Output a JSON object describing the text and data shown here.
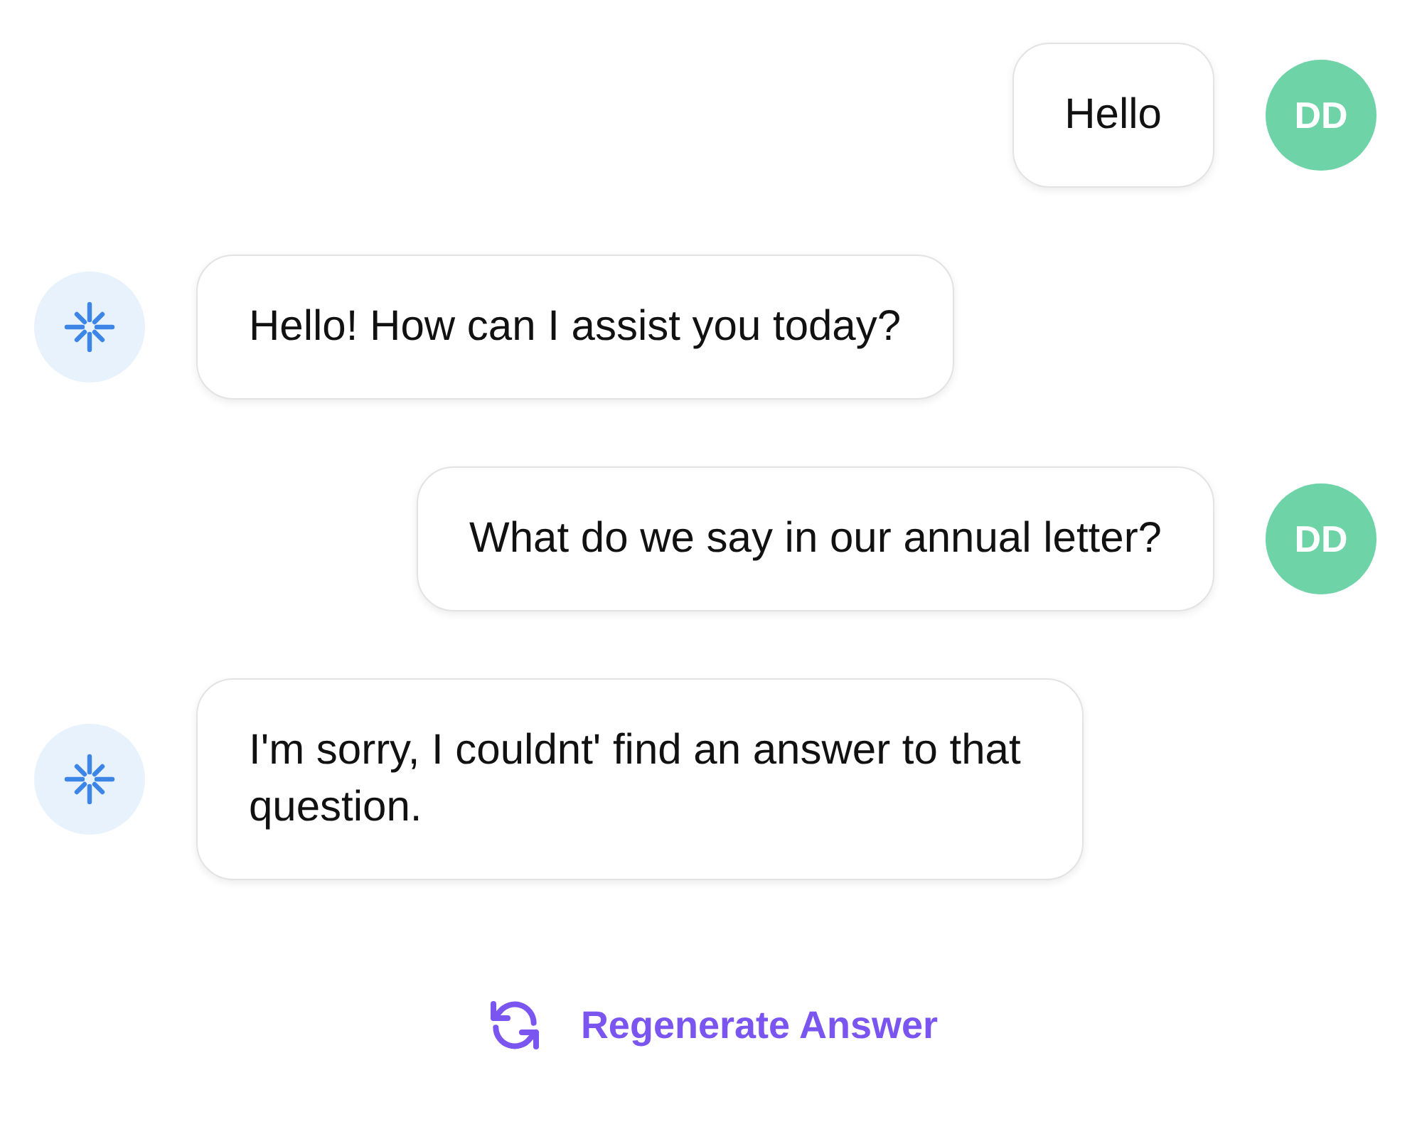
{
  "messages": [
    {
      "kind": "user",
      "avatar": "DD",
      "text": "Hello"
    },
    {
      "kind": "bot",
      "text": "Hello! How can I assist you today?"
    },
    {
      "kind": "user",
      "avatar": "DD",
      "text": "What do we say in our annual letter?"
    },
    {
      "kind": "bot",
      "text": "I'm sorry, I couldnt' find an answer to that question."
    }
  ],
  "regenerate": {
    "label": "Regenerate Answer"
  }
}
